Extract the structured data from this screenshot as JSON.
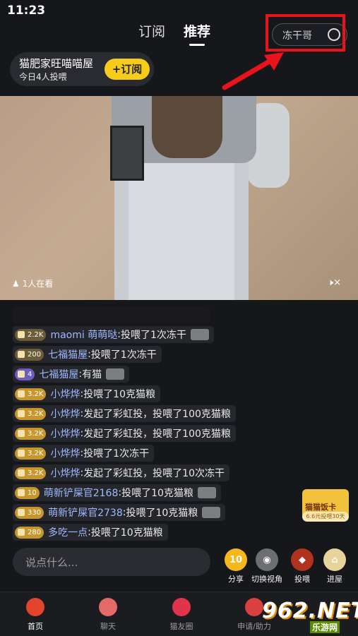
{
  "status": {
    "time": "11:23"
  },
  "tabs": [
    {
      "label": "订阅",
      "active": false
    },
    {
      "label": "推荐",
      "active": true
    }
  ],
  "search": {
    "text": "冻干哥"
  },
  "room": {
    "name": "猫肥家旺喵喵屋",
    "subtitle": "今日4人投喂",
    "subscribe_label": "+订阅"
  },
  "video": {
    "viewers": "1人在看",
    "mute_icon": "mute-icon"
  },
  "chat": [
    {
      "badge": "",
      "user": "",
      "text": "",
      "faded": true,
      "thumb": false
    },
    {
      "badge": "2.2K",
      "badge_style": "dim",
      "user": "maomi 萌萌哒",
      "text": "投喂了1次冻干",
      "thumb": true
    },
    {
      "badge": "200",
      "badge_style": "dim",
      "user": "七福猫屋",
      "text": "投喂了1次冻干",
      "thumb": false
    },
    {
      "badge": "4",
      "badge_style": "purple",
      "user": "七福猫屋",
      "text": "有猫",
      "thumb": true
    },
    {
      "badge": "3.2K",
      "badge_style": "gold",
      "user": "小烨烨",
      "text": "投喂了10克猫粮",
      "thumb": false
    },
    {
      "badge": "3.2K",
      "badge_style": "gold",
      "user": "小烨烨",
      "text": "发起了彩虹投，投喂了100克猫粮",
      "thumb": false
    },
    {
      "badge": "3.2K",
      "badge_style": "gold",
      "user": "小烨烨",
      "text": "发起了彩虹投，投喂了100克猫粮",
      "thumb": false
    },
    {
      "badge": "3.2K",
      "badge_style": "gold",
      "user": "小烨烨",
      "text": "投喂了1次冻干",
      "thumb": false
    },
    {
      "badge": "3.2K",
      "badge_style": "gold",
      "user": "小烨烨",
      "text": "发起了彩虹投，投喂了10次冻干",
      "thumb": false
    },
    {
      "badge": "10",
      "badge_style": "gold",
      "user": "萌新铲屎官2168",
      "text": "投喂了10克猫粮",
      "thumb": true
    },
    {
      "badge": "330",
      "badge_style": "gold",
      "user": "萌新铲屎官2738",
      "text": "投喂了10克猫粮",
      "thumb": true
    },
    {
      "badge": "280",
      "badge_style": "gold",
      "user": "多吃一点",
      "text": "投喂了10克猫粮",
      "thumb": false
    }
  ],
  "card": {
    "title": "猫猫饭卡",
    "sub": "6.6元投喂30天"
  },
  "input": {
    "placeholder": "说点什么..."
  },
  "actions": [
    {
      "label": "分享",
      "icon": "share-icon",
      "glyph": "10",
      "color": "#f5b71c"
    },
    {
      "label": "切换视角",
      "icon": "camera-switch-icon",
      "glyph": "◉",
      "color": "#6d6e72"
    },
    {
      "label": "投喂",
      "icon": "feed-icon",
      "glyph": "◆",
      "color": "#b1331f"
    },
    {
      "label": "进屋",
      "icon": "house-icon",
      "glyph": "⌂",
      "color": "#e8d49a"
    }
  ],
  "nav": [
    {
      "label": "首页",
      "icon": "home-icon",
      "active": true
    },
    {
      "label": "聊天",
      "icon": "chat-icon",
      "active": false
    },
    {
      "label": "猫友圈",
      "icon": "cat-circle-icon",
      "active": false
    },
    {
      "label": "申请/助力",
      "icon": "apply-icon",
      "active": false
    }
  ],
  "watermark": {
    "num": "962.NET",
    "sub": "乐游网"
  },
  "colors": {
    "accent": "#f6cc1a",
    "highlight": "#e8131b",
    "background": "#16171b"
  }
}
